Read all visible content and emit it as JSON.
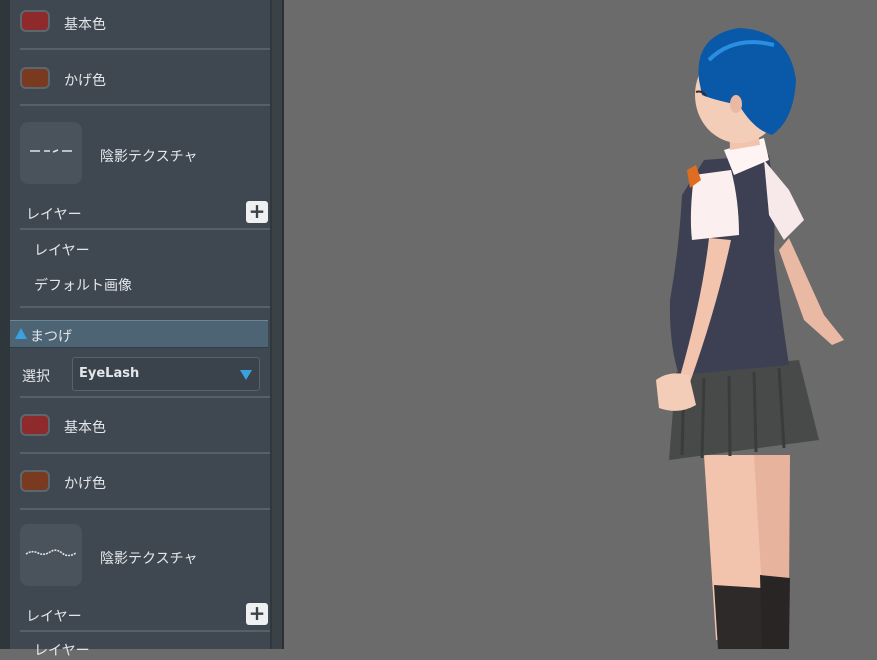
{
  "panel": {
    "upper": {
      "base_color_label": "基本色",
      "base_color": "#8e2a2c",
      "shade_color_label": "かげ色",
      "shade_color": "#7a3a20",
      "shadow_texture_label": "陰影テクスチャ",
      "layer_header_label": "レイヤー",
      "layer_items": [
        "レイヤー",
        "デフォルト画像"
      ]
    },
    "eyelash_section": {
      "title": "まつげ",
      "collapse_icon": "triangle-up-icon",
      "select_label": "選択",
      "select_value": "EyeLash",
      "select_icon": "triangle-down-icon",
      "base_color_label": "基本色",
      "base_color": "#8e2a2c",
      "shade_color_label": "かげ色",
      "shade_color": "#7a3a20",
      "shadow_texture_label": "陰影テクスチャ",
      "layer_header_label": "レイヤー",
      "layer_partial_label": "レイヤー"
    },
    "accent": "#3aa0e0"
  },
  "viewport": {
    "background": "#6b6b6b",
    "character": "3d-anime-schoolgirl-model"
  }
}
